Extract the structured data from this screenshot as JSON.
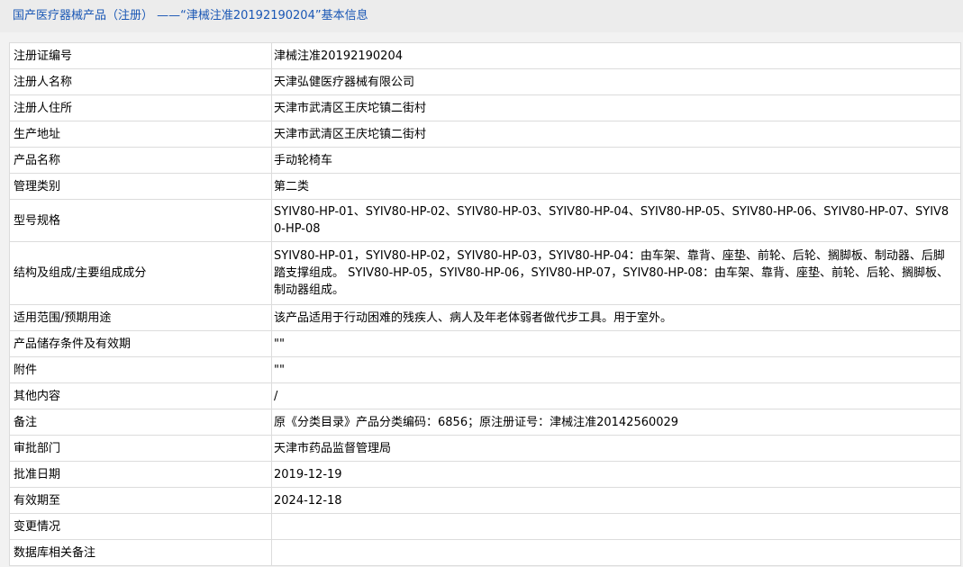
{
  "header": {
    "title": "国产医疗器械产品（注册） ——“津械注准20192190204”基本信息"
  },
  "rows": [
    {
      "label": "注册证编号",
      "value": "津械注准20192190204"
    },
    {
      "label": "注册人名称",
      "value": "天津弘健医疗器械有限公司"
    },
    {
      "label": "注册人住所",
      "value": "天津市武清区王庆坨镇二街村"
    },
    {
      "label": "生产地址",
      "value": "天津市武清区王庆坨镇二街村"
    },
    {
      "label": "产品名称",
      "value": "手动轮椅车"
    },
    {
      "label": "管理类别",
      "value": "第二类"
    },
    {
      "label": "型号规格",
      "value": "SYIV80-HP-01、SYIV80-HP-02、SYIV80-HP-03、SYIV80-HP-04、SYIV80-HP-05、SYIV80-HP-06、SYIV80-HP-07、SYIV80-HP-08"
    },
    {
      "label": "结构及组成/主要组成成分",
      "value": "SYIV80-HP-01，SYIV80-HP-02，SYIV80-HP-03，SYIV80-HP-04：由车架、靠背、座垫、前轮、后轮、搁脚板、制动器、后脚踏支撑组成。 SYIV80-HP-05，SYIV80-HP-06，SYIV80-HP-07，SYIV80-HP-08：由车架、靠背、座垫、前轮、后轮、搁脚板、制动器组成。"
    },
    {
      "label": "适用范围/预期用途",
      "value": "该产品适用于行动困难的残疾人、病人及年老体弱者做代步工具。用于室外。"
    },
    {
      "label": "产品储存条件及有效期",
      "value": "\"\""
    },
    {
      "label": "附件",
      "value": "\"\""
    },
    {
      "label": "其他内容",
      "value": "/"
    },
    {
      "label": "备注",
      "value": "原《分类目录》产品分类编码：6856；原注册证号：津械注准20142560029"
    },
    {
      "label": "审批部门",
      "value": "天津市药品监督管理局"
    },
    {
      "label": "批准日期",
      "value": "2019-12-19"
    },
    {
      "label": "有效期至",
      "value": "2024-12-18"
    },
    {
      "label": "变更情况",
      "value": ""
    },
    {
      "label": "数据库相关备注",
      "value": ""
    }
  ]
}
